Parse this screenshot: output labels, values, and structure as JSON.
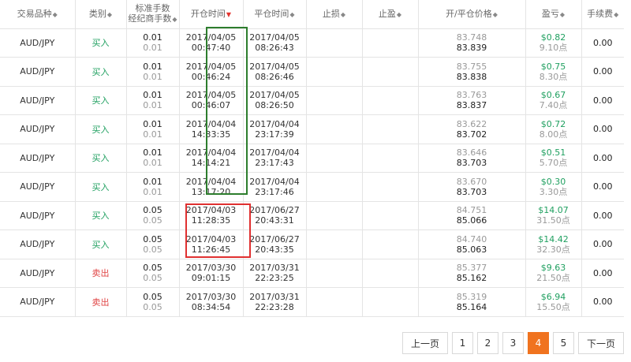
{
  "columns": [
    {
      "label": "交易品种",
      "sort": "both"
    },
    {
      "label": "类别",
      "sort": "both"
    },
    {
      "label": "标准手数",
      "label2": "经纪商手数",
      "sort": "both"
    },
    {
      "label": "开仓时间",
      "sort": "desc-active"
    },
    {
      "label": "平仓时间",
      "sort": "both"
    },
    {
      "label": "止损",
      "sort": "both"
    },
    {
      "label": "止盈",
      "sort": "both"
    },
    {
      "label": "开/平仓价格",
      "sort": "both"
    },
    {
      "label": "盈亏",
      "sort": "both"
    },
    {
      "label": "手续费",
      "sort": "both"
    }
  ],
  "rows": [
    {
      "symbol": "AUD/JPY",
      "side": "买入",
      "side_type": "buy",
      "lots_std": "0.01",
      "lots_broker": "0.01",
      "open_date": "2017/04/05",
      "open_time": "00:47:40",
      "close_date": "2017/04/05",
      "close_time": "08:26:43",
      "sl": "",
      "tp": "",
      "open_price": "83.748",
      "close_price": "83.839",
      "pl": "$0.82",
      "points": "9.10点",
      "fee": "0.00"
    },
    {
      "symbol": "AUD/JPY",
      "side": "买入",
      "side_type": "buy",
      "lots_std": "0.01",
      "lots_broker": "0.01",
      "open_date": "2017/04/05",
      "open_time": "00:46:24",
      "close_date": "2017/04/05",
      "close_time": "08:26:46",
      "sl": "",
      "tp": "",
      "open_price": "83.755",
      "close_price": "83.838",
      "pl": "$0.75",
      "points": "8.30点",
      "fee": "0.00"
    },
    {
      "symbol": "AUD/JPY",
      "side": "买入",
      "side_type": "buy",
      "lots_std": "0.01",
      "lots_broker": "0.01",
      "open_date": "2017/04/05",
      "open_time": "00:46:07",
      "close_date": "2017/04/05",
      "close_time": "08:26:50",
      "sl": "",
      "tp": "",
      "open_price": "83.763",
      "close_price": "83.837",
      "pl": "$0.67",
      "points": "7.40点",
      "fee": "0.00"
    },
    {
      "symbol": "AUD/JPY",
      "side": "买入",
      "side_type": "buy",
      "lots_std": "0.01",
      "lots_broker": "0.01",
      "open_date": "2017/04/04",
      "open_time": "14:33:35",
      "close_date": "2017/04/04",
      "close_time": "23:17:39",
      "sl": "",
      "tp": "",
      "open_price": "83.622",
      "close_price": "83.702",
      "pl": "$0.72",
      "points": "8.00点",
      "fee": "0.00"
    },
    {
      "symbol": "AUD/JPY",
      "side": "买入",
      "side_type": "buy",
      "lots_std": "0.01",
      "lots_broker": "0.01",
      "open_date": "2017/04/04",
      "open_time": "14:14:21",
      "close_date": "2017/04/04",
      "close_time": "23:17:43",
      "sl": "",
      "tp": "",
      "open_price": "83.646",
      "close_price": "83.703",
      "pl": "$0.51",
      "points": "5.70点",
      "fee": "0.00"
    },
    {
      "symbol": "AUD/JPY",
      "side": "买入",
      "side_type": "buy",
      "lots_std": "0.01",
      "lots_broker": "0.01",
      "open_date": "2017/04/04",
      "open_time": "13:17:20",
      "close_date": "2017/04/04",
      "close_time": "23:17:46",
      "sl": "",
      "tp": "",
      "open_price": "83.670",
      "close_price": "83.703",
      "pl": "$0.30",
      "points": "3.30点",
      "fee": "0.00"
    },
    {
      "symbol": "AUD/JPY",
      "side": "买入",
      "side_type": "buy",
      "lots_std": "0.05",
      "lots_broker": "0.05",
      "open_date": "2017/04/03",
      "open_time": "11:28:35",
      "close_date": "2017/06/27",
      "close_time": "20:43:31",
      "sl": "",
      "tp": "",
      "open_price": "84.751",
      "close_price": "85.066",
      "pl": "$14.07",
      "points": "31.50点",
      "fee": "0.00"
    },
    {
      "symbol": "AUD/JPY",
      "side": "买入",
      "side_type": "buy",
      "lots_std": "0.05",
      "lots_broker": "0.05",
      "open_date": "2017/04/03",
      "open_time": "11:26:45",
      "close_date": "2017/06/27",
      "close_time": "20:43:35",
      "sl": "",
      "tp": "",
      "open_price": "84.740",
      "close_price": "85.063",
      "pl": "$14.42",
      "points": "32.30点",
      "fee": "0.00"
    },
    {
      "symbol": "AUD/JPY",
      "side": "卖出",
      "side_type": "sell",
      "lots_std": "0.05",
      "lots_broker": "0.05",
      "open_date": "2017/03/30",
      "open_time": "09:01:15",
      "close_date": "2017/03/31",
      "close_time": "22:23:25",
      "sl": "",
      "tp": "",
      "open_price": "85.377",
      "close_price": "85.162",
      "pl": "$9.63",
      "points": "21.50点",
      "fee": "0.00"
    },
    {
      "symbol": "AUD/JPY",
      "side": "卖出",
      "side_type": "sell",
      "lots_std": "0.05",
      "lots_broker": "0.05",
      "open_date": "2017/03/30",
      "open_time": "08:34:54",
      "close_date": "2017/03/31",
      "close_time": "22:23:28",
      "sl": "",
      "tp": "",
      "open_price": "85.319",
      "close_price": "85.164",
      "pl": "$6.94",
      "points": "15.50点",
      "fee": "0.00"
    }
  ],
  "pagination": {
    "prev_label": "上一页",
    "pages": [
      "1",
      "2",
      "3",
      "4",
      "5"
    ],
    "current_page": "4",
    "next_label": "下一页"
  },
  "colors": {
    "buy": "#20a060",
    "sell": "#e04545",
    "profit": "#20a060",
    "active_page": "#f0731f",
    "highlight_green": "#2d7d2d",
    "highlight_red": "#e03030"
  }
}
